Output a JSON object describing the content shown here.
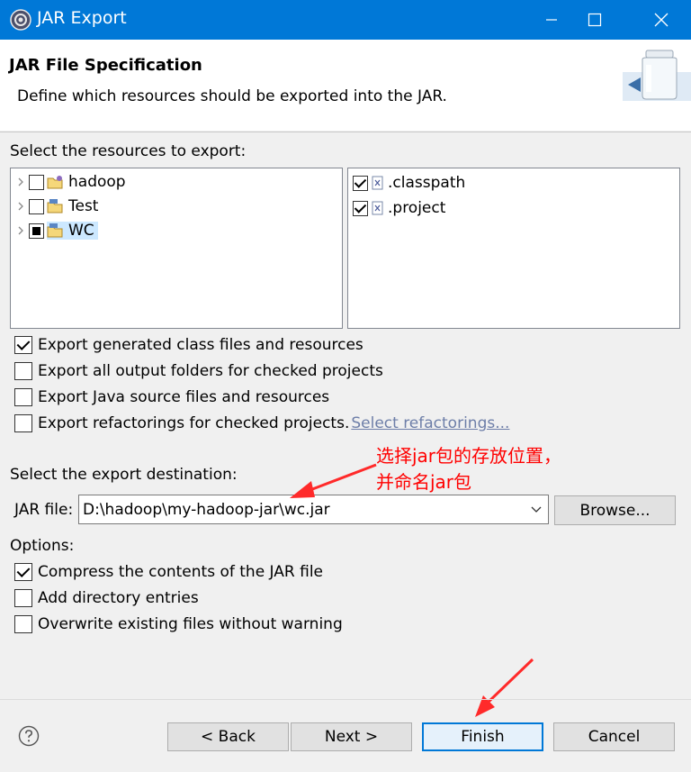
{
  "window": {
    "title": "JAR Export",
    "icons": [
      "gear-icon",
      "minimize-icon",
      "maximize-icon",
      "close-icon"
    ]
  },
  "header": {
    "title": "JAR File Specification",
    "description": "Define which resources should be exported into the JAR.",
    "banner_icon": "jar-icon"
  },
  "resources": {
    "label": "Select the resources to export:",
    "projects": [
      {
        "label": "hadoop",
        "state": "unchecked",
        "icon": "project-folder-icon"
      },
      {
        "label": "Test",
        "state": "unchecked",
        "icon": "project-folder-icon"
      },
      {
        "label": "WC",
        "state": "partial",
        "icon": "project-folder-icon",
        "selected": true
      }
    ],
    "files": [
      {
        "label": ".classpath",
        "state": "checked",
        "icon": "xml-file-icon"
      },
      {
        "label": ".project",
        "state": "checked",
        "icon": "xml-file-icon"
      }
    ]
  },
  "export_options": [
    {
      "label": "Export generated class files and resources",
      "checked": true
    },
    {
      "label": "Export all output folders for checked projects",
      "checked": false
    },
    {
      "label": "Export Java source files and resources",
      "checked": false
    },
    {
      "label": "Export refactorings for checked projects.",
      "checked": false
    }
  ],
  "select_refactorings_link": "Select refactorings...",
  "destination": {
    "label": "Select the export destination:",
    "jar_file_label": "JAR file:",
    "jar_file_value": "D:\\hadoop\\my-hadoop-jar\\wc.jar",
    "browse_label": "Browse..."
  },
  "options": {
    "label": "Options:",
    "items": [
      {
        "label": "Compress the contents of the JAR file",
        "checked": true
      },
      {
        "label": "Add directory entries",
        "checked": false
      },
      {
        "label": "Overwrite existing files without warning",
        "checked": false
      }
    ]
  },
  "annotation": {
    "line1": "选择jar包的存放位置，",
    "line2": "并命名jar包",
    "color": "#ff0000"
  },
  "footer": {
    "help_icon": "help-icon",
    "back_label": "< Back",
    "next_label": "Next >",
    "finish_label": "Finish",
    "cancel_label": "Cancel"
  },
  "colors": {
    "titlebar": "#0078d7",
    "selection": "#cce8ff",
    "link": "#6d7ea8",
    "default_button_border": "#0078d7"
  }
}
